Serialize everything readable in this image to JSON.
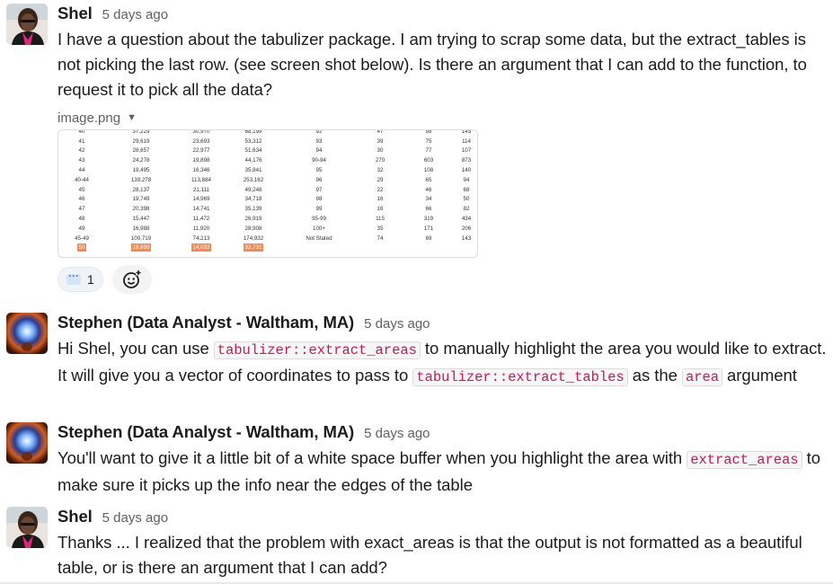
{
  "messages": [
    {
      "author": "Shel",
      "time": "5 days ago",
      "text": "I have a question about the tabulizer package. I am trying to scrap some data, but the extract_tables is not picking the last row. (see screen shot below). Is there an argument that I can add to the function, to request it to pick all the data?",
      "attachment": {
        "filename": "image.png",
        "table_rows": [
          [
            "40",
            "37,229",
            "30,970",
            "68,199",
            "92",
            "47",
            "98",
            "145"
          ],
          [
            "41",
            "29,619",
            "23,693",
            "53,312",
            "93",
            "39",
            "75",
            "114"
          ],
          [
            "42",
            "28,657",
            "22,977",
            "51,634",
            "94",
            "30",
            "77",
            "107"
          ],
          [
            "43",
            "24,278",
            "19,898",
            "44,176",
            "90-94",
            "270",
            "603",
            "873"
          ],
          [
            "44",
            "19,495",
            "16,346",
            "35,841",
            "95",
            "32",
            "108",
            "140"
          ],
          [
            "40-44",
            "139,278",
            "113,884",
            "253,162",
            "96",
            "29",
            "65",
            "94"
          ],
          [
            "45",
            "28,137",
            "21,111",
            "49,248",
            "97",
            "22",
            "46",
            "68"
          ],
          [
            "46",
            "19,749",
            "14,969",
            "34,718",
            "98",
            "16",
            "34",
            "50"
          ],
          [
            "47",
            "20,398",
            "14,741",
            "35,139",
            "99",
            "16",
            "66",
            "82"
          ],
          [
            "48",
            "15,447",
            "11,472",
            "26,919",
            "95-99",
            "115",
            "319",
            "434"
          ],
          [
            "49",
            "16,988",
            "11,920",
            "28,908",
            "100+",
            "35",
            "171",
            "206"
          ],
          [
            "45-49",
            "100,719",
            "74,213",
            "174,932",
            "Not Stated",
            "74",
            "69",
            "143"
          ]
        ],
        "highlighted_row": [
          "50",
          "18,699",
          "14,032",
          "32,731"
        ]
      },
      "reactions": [
        {
          "icon": "speech-balloon-icon",
          "count": "1"
        }
      ]
    },
    {
      "author": "Stephen (Data Analyst - Waltham, MA)",
      "time": "5 days ago",
      "parts": {
        "p1": "Hi Shel, you can use ",
        "c1": "tabulizer::extract_areas",
        "p2": " to manually highlight the area you would like to extract. It will give you a vector of coordinates to pass to ",
        "c2": "tabulizer::extract_tables",
        "p3": " as the ",
        "c3": "area",
        "p4": " argument"
      }
    },
    {
      "author": "Stephen (Data Analyst - Waltham, MA)",
      "time": "5 days ago",
      "parts": {
        "p1": "You'll want to give it a little bit of a white space buffer when you highlight the area with ",
        "c1": "extract_areas",
        "p2": " to make sure it picks up the info near the edges of the table"
      }
    },
    {
      "author": "Shel",
      "time": "5 days ago",
      "text": "Thanks ... I realized that the problem with exact_areas is that the output is not formatted as a beautiful table, or is there an argument that I can add?"
    }
  ]
}
